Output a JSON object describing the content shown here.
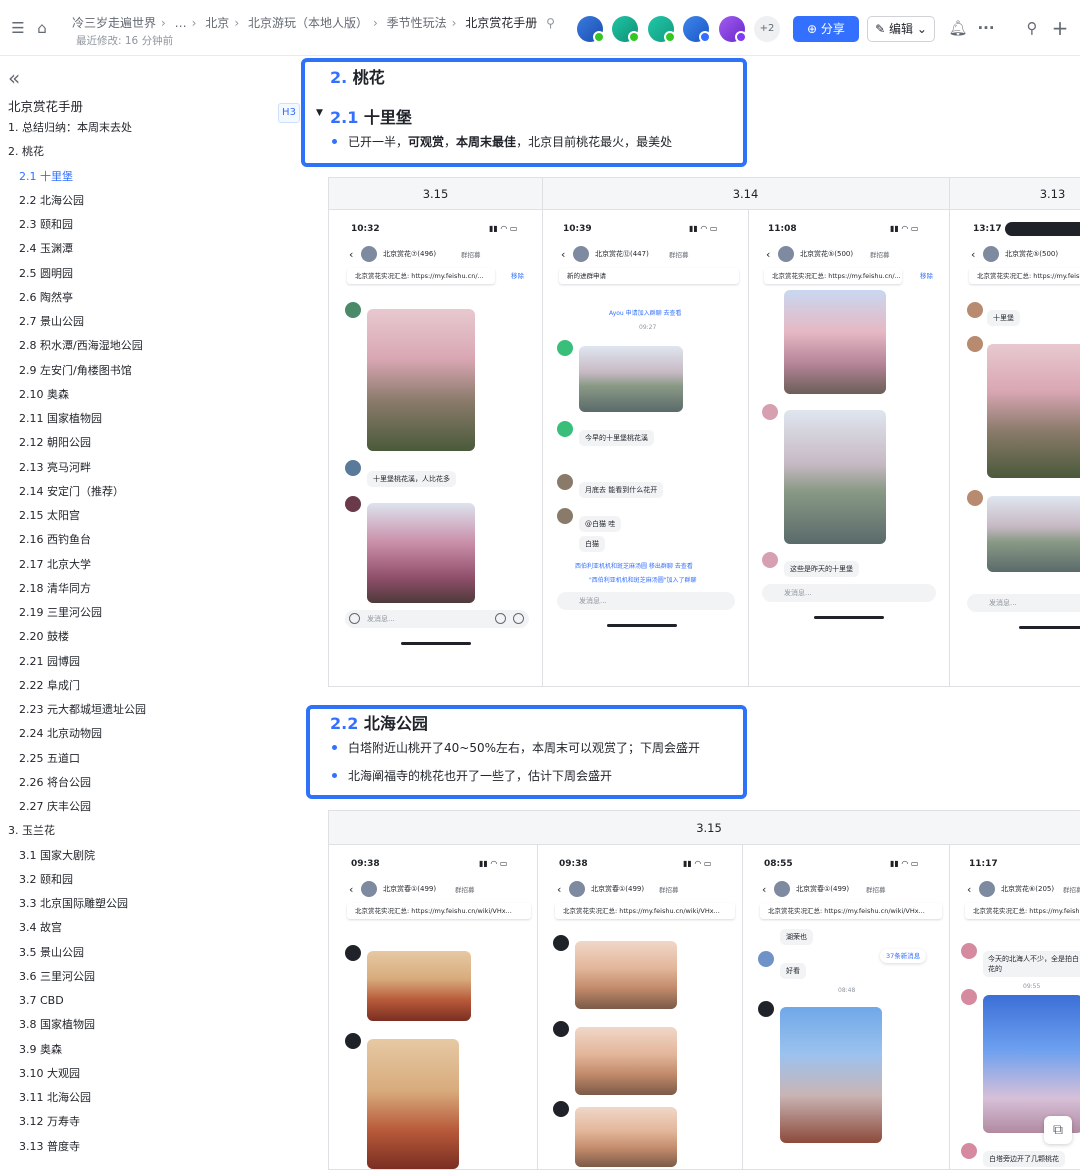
{
  "header": {
    "breadcrumbs": [
      "冷三岁走遍世界",
      "…",
      "北京",
      "北京游玩（本地人版）",
      "季节性玩法",
      "北京赏花手册"
    ],
    "last_modified": "最近修改: 16 分钟前",
    "extra_avatars": "+2",
    "share_label": "分享",
    "edit_label": "编辑"
  },
  "toc": {
    "doc_title": "北京赏花手册",
    "items": [
      {
        "label": "1. 总结归纳：本周末去处",
        "level": 1
      },
      {
        "label": "2. 桃花",
        "level": 1
      },
      {
        "label": "2.1 十里堡",
        "level": 2,
        "active": true
      },
      {
        "label": "2.2 北海公园",
        "level": 2
      },
      {
        "label": "2.3 颐和园",
        "level": 2
      },
      {
        "label": "2.4 玉渊潭",
        "level": 2
      },
      {
        "label": "2.5 圆明园",
        "level": 2
      },
      {
        "label": "2.6 陶然亭",
        "level": 2
      },
      {
        "label": "2.7 景山公园",
        "level": 2
      },
      {
        "label": "2.8 积水潭/西海湿地公园",
        "level": 2
      },
      {
        "label": "2.9 左安门/角楼图书馆",
        "level": 2
      },
      {
        "label": "2.10 奥森",
        "level": 2
      },
      {
        "label": "2.11 国家植物园",
        "level": 2
      },
      {
        "label": "2.12 朝阳公园",
        "level": 2
      },
      {
        "label": "2.13 亮马河畔",
        "level": 2
      },
      {
        "label": "2.14 安定门（推荐）",
        "level": 2
      },
      {
        "label": "2.15 太阳宫",
        "level": 2
      },
      {
        "label": "2.16 西钓鱼台",
        "level": 2
      },
      {
        "label": "2.17 北京大学",
        "level": 2
      },
      {
        "label": "2.18 清华同方",
        "level": 2
      },
      {
        "label": "2.19 三里河公园",
        "level": 2
      },
      {
        "label": "2.20 鼓楼",
        "level": 2
      },
      {
        "label": "2.21 园博园",
        "level": 2
      },
      {
        "label": "2.22 阜成门",
        "level": 2
      },
      {
        "label": "2.23 元大都城垣遗址公园",
        "level": 2
      },
      {
        "label": "2.24 北京动物园",
        "level": 2
      },
      {
        "label": "2.25 五道口",
        "level": 2
      },
      {
        "label": "2.26 将台公园",
        "level": 2
      },
      {
        "label": "2.27 庆丰公园",
        "level": 2
      },
      {
        "label": "3. 玉兰花",
        "level": 1
      },
      {
        "label": "3.1 国家大剧院",
        "level": 2
      },
      {
        "label": "3.2 颐和园",
        "level": 2
      },
      {
        "label": "3.3 北京国际雕塑公园",
        "level": 2
      },
      {
        "label": "3.4 故宫",
        "level": 2
      },
      {
        "label": "3.5 景山公园",
        "level": 2
      },
      {
        "label": "3.6 三里河公园",
        "level": 2
      },
      {
        "label": "3.7 CBD",
        "level": 2
      },
      {
        "label": "3.8 国家植物园",
        "level": 2
      },
      {
        "label": "3.9 奥森",
        "level": 2
      },
      {
        "label": "3.10 大观园",
        "level": 2
      },
      {
        "label": "3.11 北海公园",
        "level": 2
      },
      {
        "label": "3.12 万寿寺",
        "level": 2
      },
      {
        "label": "3.13 普度寺",
        "level": 2
      }
    ]
  },
  "content": {
    "h2_num": "2.",
    "h2_text": "桃花",
    "heading_tag": "H3",
    "s21_num": "2.1",
    "s21_text": "十里堡",
    "s21_b_pre": "已开一半，",
    "s21_b_bold1": "可观赏",
    "s21_b_mid": "，",
    "s21_b_bold2": "本周末最佳",
    "s21_b_post": "，北京目前桃花最火，最美处",
    "table1_cols": [
      "3.15",
      "3.14",
      "3.13"
    ],
    "s22_num": "2.2",
    "s22_text": "北海公园",
    "s22_b1": "白塔附近山桃开了40~50%左右，本周末可以观赏了；下周会盛开",
    "s22_b2": "北海阐福寺的桃花也开了一些了，估计下周会盛开",
    "table2_cols": [
      "3.15"
    ]
  },
  "phones1": [
    {
      "time": "10:32",
      "title": "北京赏花⑦(496)",
      "pin": "北京赏花实况汇总: https://my.feishu.cn/...",
      "remove": "移除",
      "meta": "群招募",
      "caption": "十里堡桃花溪，人比花多",
      "input": "发消息..."
    },
    {
      "time": "10:39",
      "title": "北京赏花⑫(447)",
      "pin": "新的进群申请",
      "meta": "群招募",
      "cap1": "今早的十里堡桃花溪",
      "cap2": "月底去 能看到什么花开",
      "cap3": "@白猫 哇",
      "cap4": "白猫",
      "sys1": "Ayou 申请加入群聊 去查看",
      "time_mid": "09:27",
      "sys2": "西伯利亚机机和斑芝麻汤圆 移出群聊 去查看",
      "sys3": "\"西伯利亚机机和斑芝麻汤圆\"加入了群聊",
      "input": "发消息..."
    },
    {
      "time": "11:08",
      "title": "北京赏花⑤(500)",
      "pin": "北京赏花实况汇总: https://my.feishu.cn/...",
      "remove": "移除",
      "meta": "群招募",
      "caption": "这些是昨天的十里堡",
      "input": "发消息..."
    },
    {
      "time": "13:17",
      "title": "北京赏花⑤(500)",
      "pin": "北京赏花实况汇总: https://my.feish",
      "meta": "群招募",
      "caption": "十里堡",
      "input": "发消息..."
    }
  ],
  "phones2": [
    {
      "time": "09:38",
      "title": "北京赏春①(499)",
      "pin": "北京赏花实况汇总: https://my.feishu.cn/wiki/VHx...",
      "meta": "群招募"
    },
    {
      "time": "09:38",
      "title": "北京赏春①(499)",
      "pin": "北京赏花实况汇总: https://my.feishu.cn/wiki/VHx...",
      "meta": "群招募"
    },
    {
      "time": "08:55",
      "title": "北京赏春①(499)",
      "pin": "北京赏花实况汇总: https://my.feishu.cn/wiki/VHx...",
      "meta": "群招募",
      "c1": "湖荣也",
      "c2": "好看",
      "new_msgs": "37条新消息",
      "time_mid": "08:48"
    },
    {
      "time": "11:17",
      "title": "北京赏花⑥(205)",
      "pin": "北京赏花实况汇总: https://my.feishu",
      "meta": "群招募",
      "c1": "今天的北海人不少，全是拍白花的",
      "time_mid": "09:55",
      "c2": "白塔旁边开了几颗桃花"
    }
  ]
}
